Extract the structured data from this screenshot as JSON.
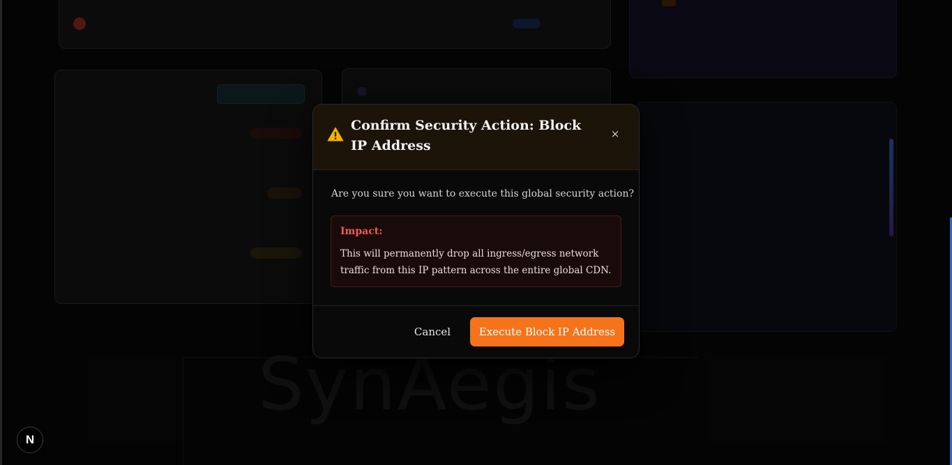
{
  "background": {
    "brand_text": "SynAegis",
    "next_badge": "N"
  },
  "modal": {
    "title": "Confirm Security Action: Block IP Address",
    "close_symbol": "×",
    "question": "Are you sure you want to execute this global security action?",
    "impact_label": "Impact:",
    "impact_text": "This will permanently drop all ingress/egress network traffic from this IP pattern across the entire global CDN.",
    "cancel_label": "Cancel",
    "execute_label": "Execute Block IP Address",
    "icon": "warning-icon"
  },
  "colors": {
    "accent": "#f5731a",
    "impact_red": "#ef5c4f",
    "header_bg": "#1c1409"
  }
}
